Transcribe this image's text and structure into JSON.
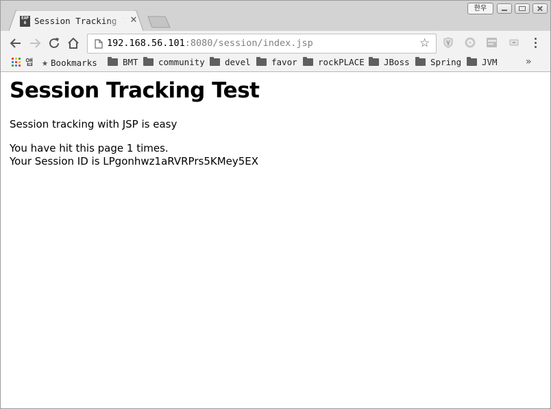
{
  "tab": {
    "title": "Session Tracking Test",
    "favicon_top": "EAP",
    "favicon_bottom": "6",
    "close_glyph": "✕"
  },
  "ime_indicator": "한우",
  "address_bar": {
    "host": "192.168.56.101",
    "path": ":8080/session/index.jsp"
  },
  "bookmarks": {
    "apps_label": "앱",
    "items": [
      {
        "label": "Bookmarks",
        "icon": "star-icon"
      },
      {
        "label": "BMT",
        "icon": "folder-icon"
      },
      {
        "label": "community",
        "icon": "folder-icon"
      },
      {
        "label": "devel",
        "icon": "folder-icon"
      },
      {
        "label": "favor",
        "icon": "folder-icon"
      },
      {
        "label": "rockPLACE",
        "icon": "folder-icon"
      },
      {
        "label": "JBoss",
        "icon": "folder-icon"
      },
      {
        "label": "Spring",
        "icon": "folder-icon"
      },
      {
        "label": "JVM",
        "icon": "folder-icon"
      }
    ],
    "overflow_glyph": "»"
  },
  "page": {
    "heading": "Session Tracking Test",
    "intro": "Session tracking with JSP is easy",
    "hits_line": "You have hit this page 1 times.",
    "session_line": "Your Session ID is LPgonhwz1aRVRPrs5KMey5EX"
  },
  "colors": {
    "tab_strip": "#d3d3d3",
    "toolbar": "#f2f2f2",
    "url_host": "#000000",
    "url_path": "#808080",
    "apps_grid": [
      "#e94235",
      "#fbbc04",
      "#34a853",
      "#4285f4"
    ]
  }
}
